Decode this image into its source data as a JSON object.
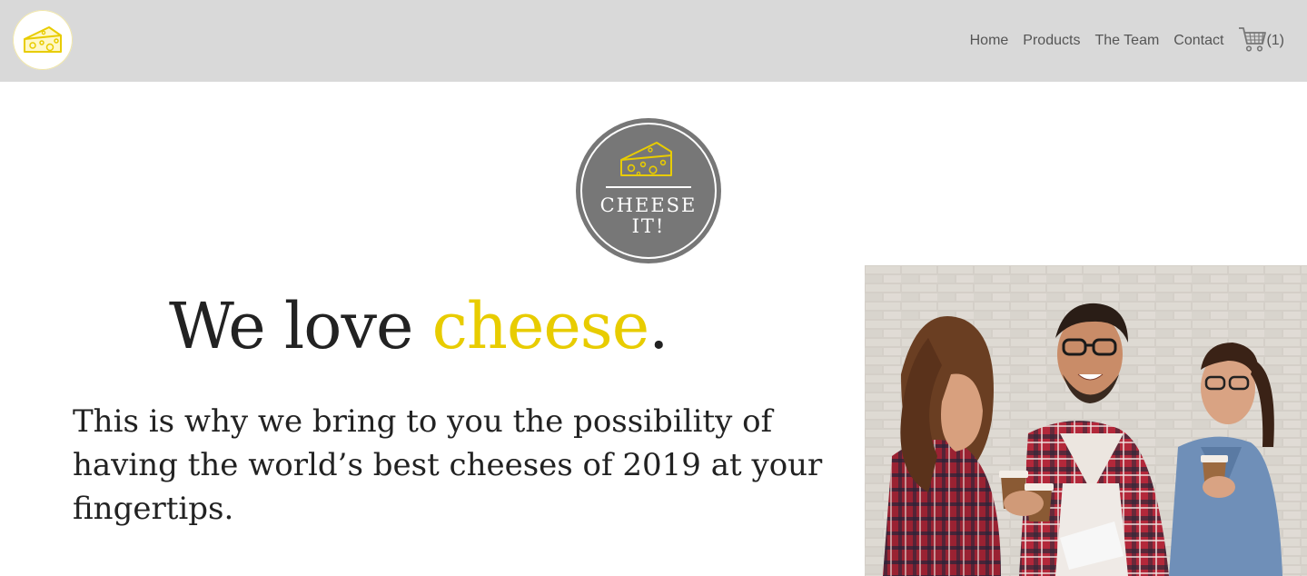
{
  "nav": {
    "links": [
      "Home",
      "Products",
      "The Team",
      "Contact"
    ],
    "cart_count": "(1)",
    "logo_icon": "cheese-logo-icon",
    "cart_icon": "shopping-cart-icon"
  },
  "hero": {
    "emblem_line1": "CHEESE",
    "emblem_line2": "IT!",
    "headline_part1": "We love ",
    "headline_accent": "cheese",
    "headline_end": ".",
    "subtext": "This is why we bring to you the possibility of having the world’s best cheeses of 2019 at your fingertips."
  },
  "colors": {
    "navbar_bg": "#d9d9d9",
    "accent_yellow": "#e8cc00",
    "emblem_gray": "#777777",
    "text_dark": "#222222"
  }
}
